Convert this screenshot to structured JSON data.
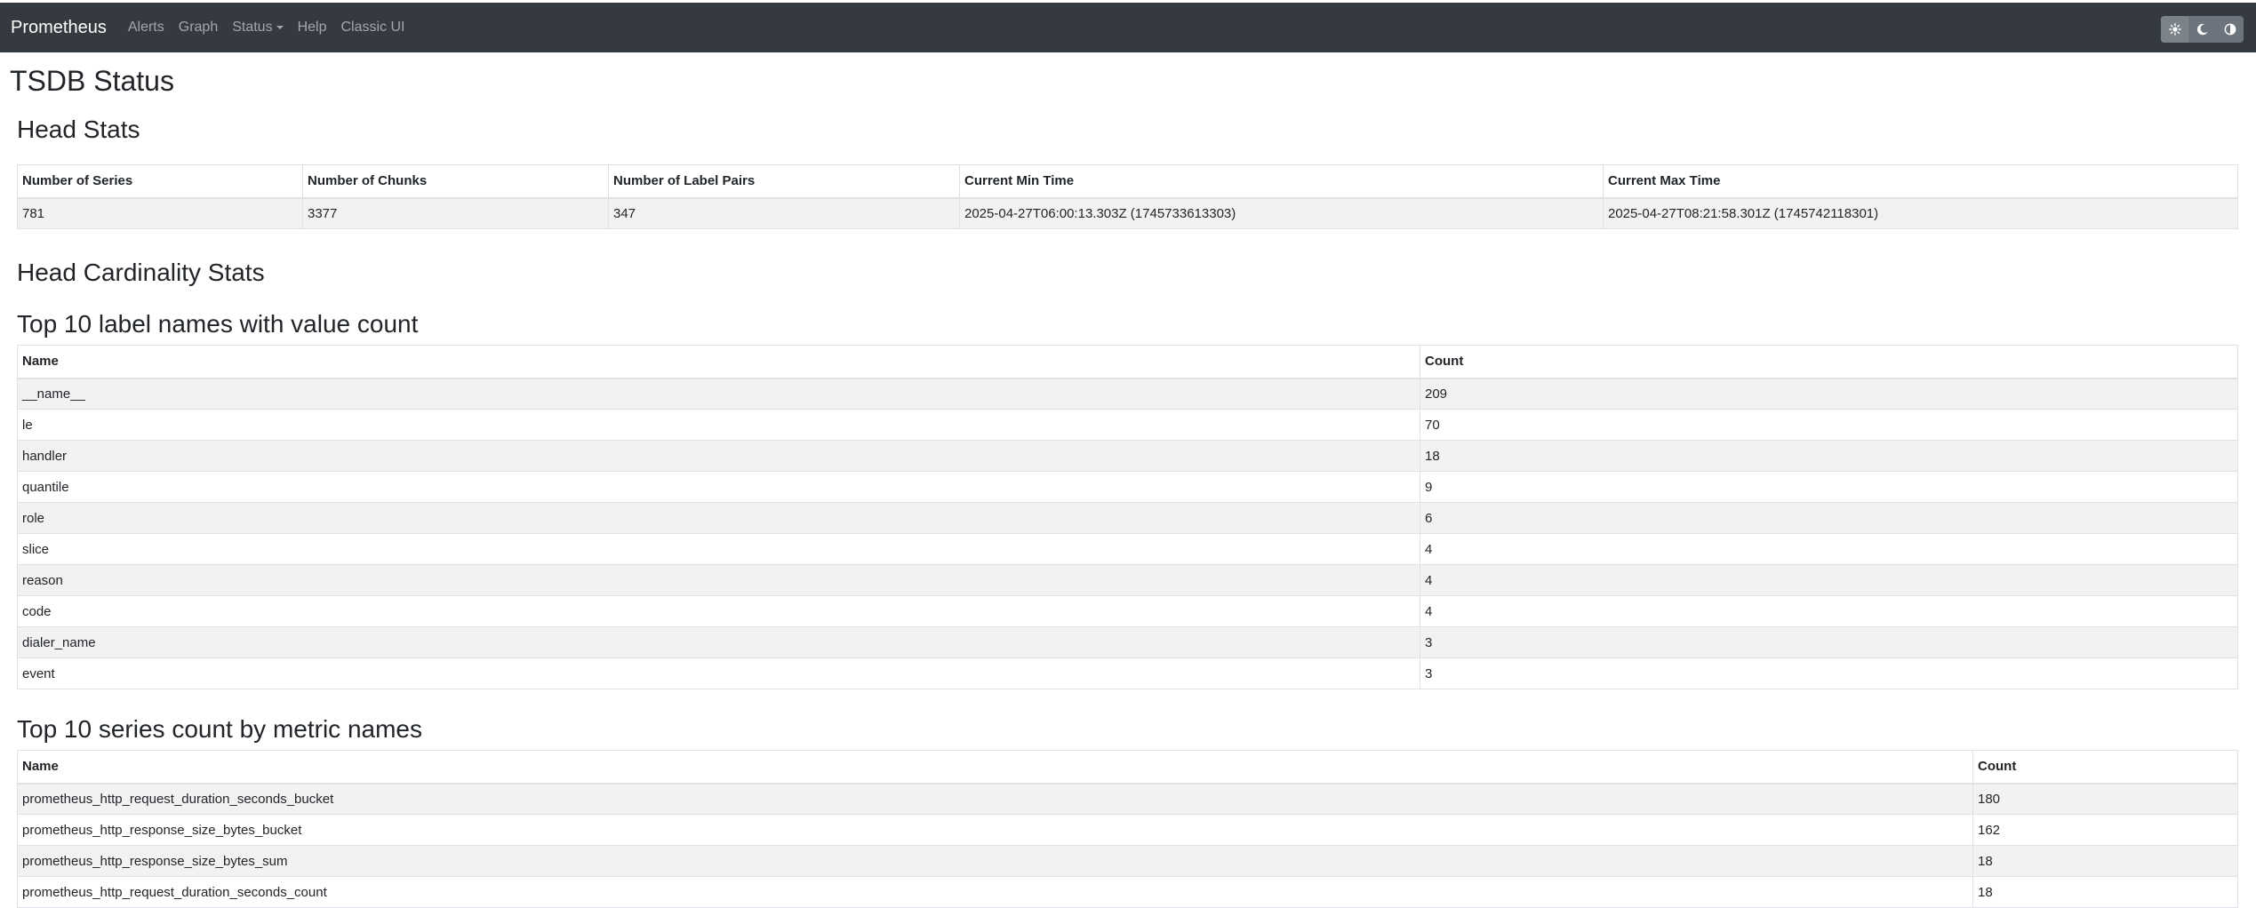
{
  "navbar": {
    "brand": "Prometheus",
    "items": [
      {
        "label": "Alerts"
      },
      {
        "label": "Graph"
      },
      {
        "label": "Status"
      },
      {
        "label": "Help"
      },
      {
        "label": "Classic UI"
      }
    ],
    "theme_icons": [
      "sun-icon",
      "moon-icon",
      "half-circle-icon"
    ]
  },
  "page": {
    "title": "TSDB Status"
  },
  "head_stats": {
    "title": "Head Stats",
    "columns": [
      "Number of Series",
      "Number of Chunks",
      "Number of Label Pairs",
      "Current Min Time",
      "Current Max Time"
    ],
    "row": [
      "781",
      "3377",
      "347",
      "2025-04-27T06:00:13.303Z (1745733613303)",
      "2025-04-27T08:21:58.301Z (1745742118301)"
    ]
  },
  "cardinality": {
    "title": "Head Cardinality Stats"
  },
  "label_names": {
    "title": "Top 10 label names with value count",
    "columns": [
      "Name",
      "Count"
    ],
    "rows": [
      [
        "__name__",
        "209"
      ],
      [
        "le",
        "70"
      ],
      [
        "handler",
        "18"
      ],
      [
        "quantile",
        "9"
      ],
      [
        "role",
        "6"
      ],
      [
        "slice",
        "4"
      ],
      [
        "reason",
        "4"
      ],
      [
        "code",
        "4"
      ],
      [
        "dialer_name",
        "3"
      ],
      [
        "event",
        "3"
      ]
    ]
  },
  "metric_names": {
    "title": "Top 10 series count by metric names",
    "columns": [
      "Name",
      "Count"
    ],
    "rows": [
      [
        "prometheus_http_request_duration_seconds_bucket",
        "180"
      ],
      [
        "prometheus_http_response_size_bytes_bucket",
        "162"
      ],
      [
        "prometheus_http_response_size_bytes_sum",
        "18"
      ],
      [
        "prometheus_http_request_duration_seconds_count",
        "18"
      ]
    ]
  }
}
